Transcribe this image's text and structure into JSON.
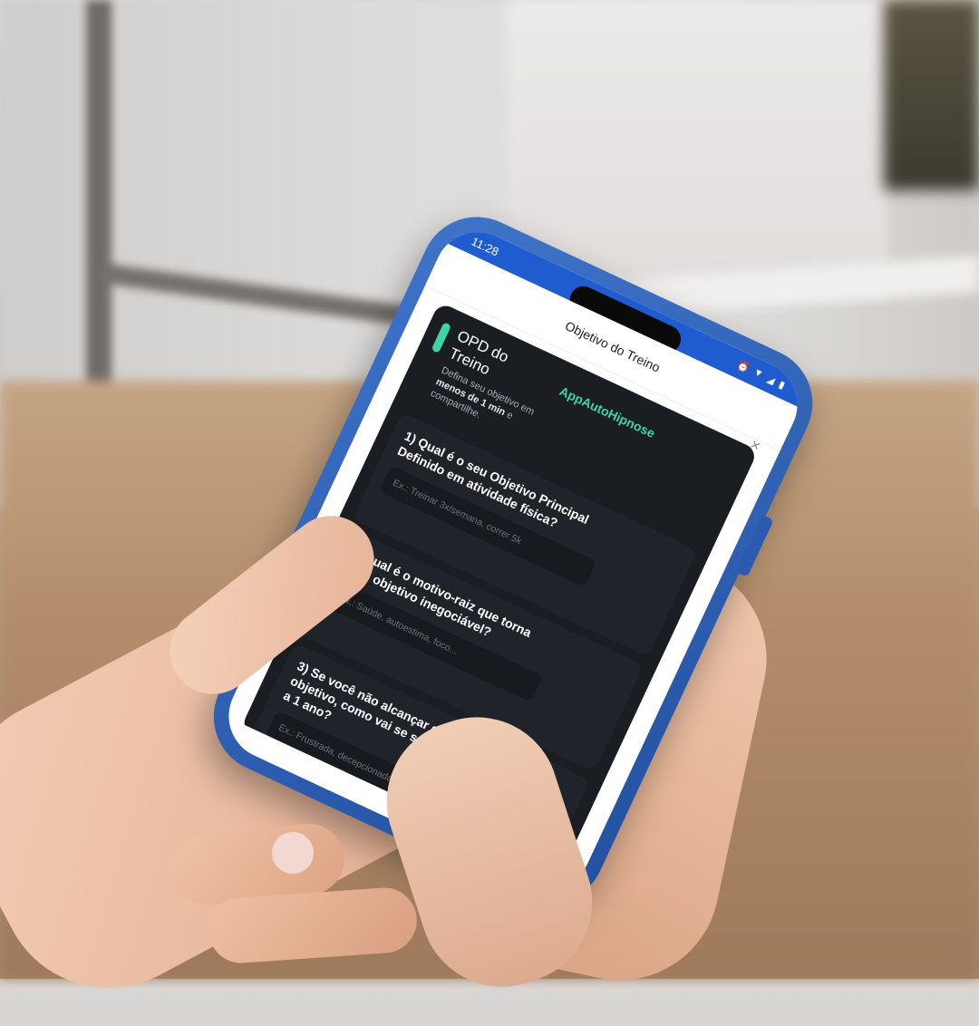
{
  "status_bar": {
    "time": "11:28"
  },
  "modal": {
    "title": "Objetivo do Treino",
    "close_symbol": "×"
  },
  "card": {
    "title": "OPD do Treino",
    "brand": "AppAutoHipnose",
    "subtitle_prefix": "Defina seu objetivo em",
    "subtitle_bold": "menos de 1 min",
    "subtitle_suffix": "e compartilhe.",
    "accent_color": "#3fd4a8"
  },
  "questions": [
    {
      "text": "1) Qual é o seu Objetivo Principal Definido em atividade física?",
      "placeholder": "Ex.: Treinar 3x/semana, correr 5k"
    },
    {
      "text": "2) Qual é o motivo-raiz que torna esse objetivo inegociável?",
      "placeholder": "Ex.: Saúde, autoestima, foco..."
    },
    {
      "text": "3) Se você não alcançar esse objetivo, como vai se sentir daqui a 1 ano?",
      "placeholder": "Ex.: Frustrada, decepcionada..."
    }
  ],
  "whatsapp": {
    "icon": "whatsapp-icon",
    "color": "#2fc45e"
  },
  "case_color": "#2f63b8"
}
